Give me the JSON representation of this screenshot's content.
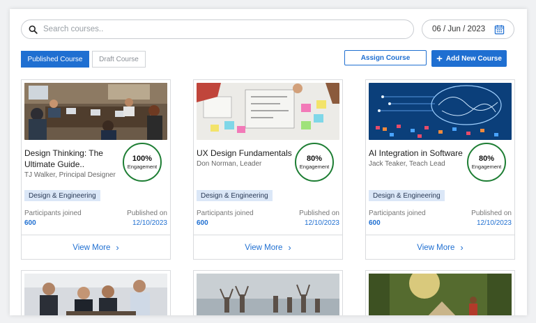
{
  "search": {
    "placeholder": "Search courses.."
  },
  "date": {
    "value": "06 / Jun / 2023"
  },
  "tabs": [
    {
      "label": "Published Course",
      "active": true
    },
    {
      "label": "Draft Course",
      "active": false
    }
  ],
  "actions": {
    "assign_label": "Assign Course",
    "add_label": "Add New Course"
  },
  "colors": {
    "accent": "#1f6fd1",
    "ring": "#1e7e34",
    "tag_bg": "#dbe7f7"
  },
  "courses": [
    {
      "title": "Design Thinking: The Ultimate Guide..",
      "author": "TJ Walker, Principal Designer",
      "tag": "Design & Engineering",
      "engagement": "100%",
      "engagement_label": "Engagement",
      "participants_label": "Participants joined",
      "participants": "600",
      "published_label": "Published on",
      "published": "12/10/2023",
      "cta": "View More"
    },
    {
      "title": "UX Design Fundamentals",
      "author": "Don Norman, Leader",
      "tag": "Design & Engineering",
      "engagement": "80%",
      "engagement_label": "Engagement",
      "participants_label": "Participants joined",
      "participants": "600",
      "published_label": "Published on",
      "published": "12/10/2023",
      "cta": "View More"
    },
    {
      "title": "AI Integration in Software",
      "author": "Jack Teaker, Teach Lead",
      "tag": "Design & Engineering",
      "engagement": "80%",
      "engagement_label": "Engagement",
      "participants_label": "Participants joined",
      "participants": "600",
      "published_label": "Published on",
      "published": "12/10/2023",
      "cta": "View More"
    }
  ]
}
